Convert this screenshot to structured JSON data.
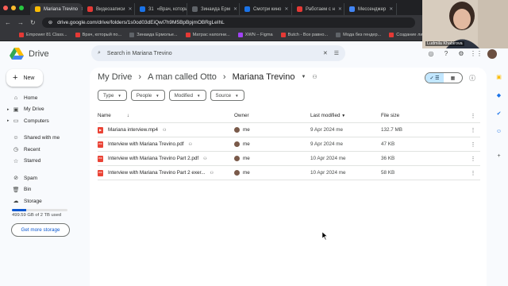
{
  "browser": {
    "tabs": [
      {
        "label": "Mariana Trevino",
        "active": true,
        "color": "#fbbc04"
      },
      {
        "label": "Видеозаписи",
        "active": false,
        "color": "#e53935"
      },
      {
        "label": "«Врач, которы",
        "active": false,
        "color": "#1a73e8",
        "prefix": "31"
      },
      {
        "label": "Зинаида Ерм",
        "active": false,
        "color": "#5f6368"
      },
      {
        "label": "Смотри кино",
        "active": false,
        "color": "#1a73e8"
      },
      {
        "label": "Работаем с н",
        "active": false,
        "color": "#e53935"
      },
      {
        "label": "Мессенджер",
        "active": false,
        "color": "#4285f4"
      }
    ],
    "url": "drive.google.com/drive/folders/1s0od03dEiQwl7h9M5BpBpjmOBRgLeIhL",
    "bookmarks": [
      {
        "label": "Empower 81 Class...",
        "color": "#e53935"
      },
      {
        "label": "Врач, который по...",
        "color": "#e53935"
      },
      {
        "label": "Зинаида Ермолье...",
        "color": "#5f6368"
      },
      {
        "label": "Матрас наполни...",
        "color": "#e53935"
      },
      {
        "label": "XWN – Figma",
        "color": "#a142f4"
      },
      {
        "label": "Butch - Все равно...",
        "color": "#e53935"
      },
      {
        "label": "Мода без гендер...",
        "color": "#5f6368"
      },
      {
        "label": "Создание ли",
        "color": "#e53935"
      }
    ]
  },
  "webcam": {
    "name": "Ludmila Khabirova"
  },
  "drive": {
    "logo_text": "Drive",
    "search_placeholder": "Search in Mariana Trevino",
    "new_label": "New",
    "sidebar": [
      {
        "label": "Home",
        "icon": "home-icon",
        "glyph": "⌂"
      },
      {
        "label": "My Drive",
        "icon": "my-drive-icon",
        "glyph": "▣",
        "caret": true
      },
      {
        "label": "Computers",
        "icon": "computers-icon",
        "glyph": "▭",
        "caret": true
      },
      {
        "gap": true
      },
      {
        "label": "Shared with me",
        "icon": "shared-icon",
        "glyph": "☺"
      },
      {
        "label": "Recent",
        "icon": "recent-icon",
        "glyph": "◷"
      },
      {
        "label": "Starred",
        "icon": "star-icon",
        "glyph": "☆"
      },
      {
        "gap": true
      },
      {
        "label": "Spam",
        "icon": "spam-icon",
        "glyph": "⊘"
      },
      {
        "label": "Bin",
        "icon": "bin-icon",
        "glyph": "🗑"
      },
      {
        "label": "Storage",
        "icon": "cloud-icon",
        "glyph": "☁"
      }
    ],
    "storage": {
      "text": "499.59 GB of 2 TB used",
      "used_fraction": 0.25,
      "button": "Get more storage"
    },
    "breadcrumb": [
      "My Drive",
      "A man called Otto",
      "Mariana Trevino"
    ],
    "filters": [
      "Type",
      "People",
      "Modified",
      "Source"
    ],
    "columns": {
      "name": "Name",
      "owner": "Owner",
      "modified": "Last modified",
      "size": "File size"
    },
    "files": [
      {
        "name": "Mariana interview.mp4",
        "type": "video",
        "owner": "me",
        "modified": "9 Apr 2024 me",
        "size": "132.7 MB"
      },
      {
        "name": "Interview with Mariana Trevino.pdf",
        "type": "pdf",
        "owner": "me",
        "modified": "9 Apr 2024 me",
        "size": "47 KB"
      },
      {
        "name": "Interview with Mariana Trevino Part 2.pdf",
        "type": "pdf",
        "owner": "me",
        "modified": "10 Apr 2024 me",
        "size": "36 KB"
      },
      {
        "name": "Interview with Mariana Trevino Part 2 exer...",
        "type": "pdf",
        "owner": "me",
        "modified": "10 Apr 2024 me",
        "size": "58 KB"
      }
    ]
  },
  "colors": {
    "accent": "#0b57d0",
    "pdf": "#ea4335",
    "video": "#ea4335",
    "selected_toggle": "#c2e7ff"
  }
}
